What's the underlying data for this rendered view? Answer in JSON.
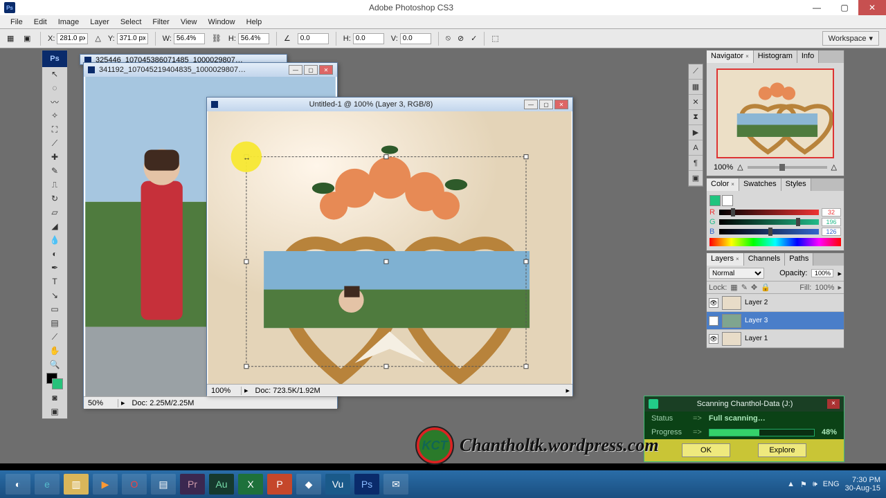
{
  "app": {
    "title": "Adobe Photoshop CS3",
    "ps_label": "Ps"
  },
  "menu": [
    "File",
    "Edit",
    "Image",
    "Layer",
    "Select",
    "Filter",
    "View",
    "Window",
    "Help"
  ],
  "options": {
    "x_label": "X:",
    "x_val": "281.0 px",
    "y_label": "Y:",
    "y_val": "371.0 px",
    "w_label": "W:",
    "w_val": "56.4%",
    "h_label": "H:",
    "h_val": "56.4%",
    "a_label": "0.0",
    "hskew_label": "H:",
    "hskew_val": "0.0",
    "vskew_label": "V:",
    "vskew_val": "0.0",
    "workspace_label": "Workspace"
  },
  "documents": {
    "back1": {
      "title": "325446_107045386071485_1000029807…",
      "zoom": "50%",
      "doc": "Doc: 2.25M/2.25M"
    },
    "back2": {
      "title": "341192_107045219404835_1000029807…"
    },
    "front": {
      "title": "Untitled-1 @ 100% (Layer 3, RGB/8)",
      "zoom": "100%",
      "doc": "Doc: 723.5K/1.92M"
    }
  },
  "panels": {
    "navigator": {
      "tabs": [
        "Navigator",
        "Histogram",
        "Info"
      ],
      "zoom": "100%"
    },
    "color": {
      "tabs": [
        "Color",
        "Swatches",
        "Styles"
      ],
      "r_label": "R",
      "r_val": "32",
      "g_label": "G",
      "g_val": "196",
      "b_label": "B",
      "b_val": "126"
    },
    "layers": {
      "tabs": [
        "Layers",
        "Channels",
        "Paths"
      ],
      "blend": "Normal",
      "opacity_label": "Opacity:",
      "opacity_val": "100%",
      "lock_label": "Lock:",
      "fill_label": "Fill:",
      "fill_val": "100%",
      "items": [
        {
          "name": "Layer 2"
        },
        {
          "name": "Layer 3"
        },
        {
          "name": "Layer 1"
        }
      ]
    }
  },
  "scan": {
    "title": "Scanning Chanthol-Data (J:)",
    "status_label": "Status",
    "status_val": "Full scanning…",
    "progress_label": "Progress",
    "progress_pct": "48%",
    "ok": "OK",
    "explore": "Explore"
  },
  "watermark": {
    "logo": "KCT",
    "text": "Chantholtk.wordpress.com"
  },
  "tray": {
    "lang": "ENG",
    "time": "7:30 PM",
    "date": "30-Aug-15"
  }
}
